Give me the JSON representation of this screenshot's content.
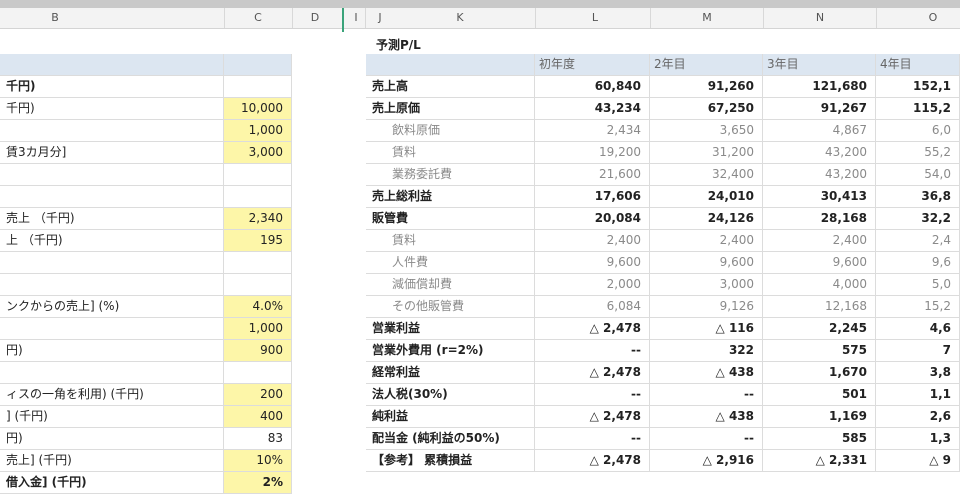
{
  "columns": [
    "B",
    "C",
    "D",
    "I",
    "J",
    "K",
    "L",
    "M",
    "N",
    "O"
  ],
  "left_panel": {
    "rows": [
      {
        "label": "",
        "value": ""
      },
      {
        "label": "千円)",
        "value": ""
      },
      {
        "label": "千円)",
        "value": "10,000"
      },
      {
        "label": "",
        "value": "1,000"
      },
      {
        "label": "賃3カ月分]",
        "value": "3,000"
      },
      {
        "label": "",
        "value": ""
      },
      {
        "label": "",
        "value": ""
      },
      {
        "label": "売上 （千円)",
        "value": "2,340"
      },
      {
        "label": "上 （千円)",
        "value": "195"
      },
      {
        "label": "",
        "value": ""
      },
      {
        "label": "",
        "value": ""
      },
      {
        "label": "ンクからの売上] (%)",
        "value": "4.0%"
      },
      {
        "label": "",
        "value": "1,000"
      },
      {
        "label": "円)",
        "value": "900"
      },
      {
        "label": "",
        "value": ""
      },
      {
        "label": "ィスの一角を利用) (千円)",
        "value": "200"
      },
      {
        "label": "] (千円)",
        "value": "400"
      },
      {
        "label": "円)",
        "value": "83"
      },
      {
        "label": "売上] (千円)",
        "value": "10%"
      },
      {
        "label": "借入金] (千円)",
        "value": "2%"
      }
    ]
  },
  "pl": {
    "title": "予測P/L",
    "headers": [
      "初年度",
      "2年目",
      "3年目",
      "4年目"
    ],
    "rows": [
      {
        "label": "売上高",
        "bold": true,
        "indent": false,
        "values": [
          "60,840",
          "91,260",
          "121,680",
          "152,1"
        ]
      },
      {
        "label": "売上原価",
        "bold": true,
        "indent": false,
        "values": [
          "43,234",
          "67,250",
          "91,267",
          "115,2"
        ]
      },
      {
        "label": "飲料原価",
        "bold": false,
        "indent": true,
        "values": [
          "2,434",
          "3,650",
          "4,867",
          "6,0"
        ]
      },
      {
        "label": "賃料",
        "bold": false,
        "indent": true,
        "values": [
          "19,200",
          "31,200",
          "43,200",
          "55,2"
        ]
      },
      {
        "label": "業務委託費",
        "bold": false,
        "indent": true,
        "values": [
          "21,600",
          "32,400",
          "43,200",
          "54,0"
        ]
      },
      {
        "label": "売上総利益",
        "bold": true,
        "indent": false,
        "values": [
          "17,606",
          "24,010",
          "30,413",
          "36,8"
        ]
      },
      {
        "label": "販管費",
        "bold": true,
        "indent": false,
        "values": [
          "20,084",
          "24,126",
          "28,168",
          "32,2"
        ]
      },
      {
        "label": "賃料",
        "bold": false,
        "indent": true,
        "values": [
          "2,400",
          "2,400",
          "2,400",
          "2,4"
        ]
      },
      {
        "label": "人件費",
        "bold": false,
        "indent": true,
        "values": [
          "9,600",
          "9,600",
          "9,600",
          "9,6"
        ]
      },
      {
        "label": "減価償却費",
        "bold": false,
        "indent": true,
        "values": [
          "2,000",
          "3,000",
          "4,000",
          "5,0"
        ]
      },
      {
        "label": "その他販管費",
        "bold": false,
        "indent": true,
        "values": [
          "6,084",
          "9,126",
          "12,168",
          "15,2"
        ]
      },
      {
        "label": "営業利益",
        "bold": true,
        "indent": false,
        "values": [
          "△ 2,478",
          "△ 116",
          "2,245",
          "4,6"
        ]
      },
      {
        "label": "営業外費用 (r=2%)",
        "bold": true,
        "indent": false,
        "values": [
          "--",
          "322",
          "575",
          "7"
        ]
      },
      {
        "label": "経常利益",
        "bold": true,
        "indent": false,
        "values": [
          "△ 2,478",
          "△ 438",
          "1,670",
          "3,8"
        ]
      },
      {
        "label": "法人税(30%)",
        "bold": true,
        "indent": false,
        "values": [
          "--",
          "--",
          "501",
          "1,1"
        ]
      },
      {
        "label": "純利益",
        "bold": true,
        "indent": false,
        "values": [
          "△ 2,478",
          "△ 438",
          "1,169",
          "2,6"
        ]
      },
      {
        "label": "配当金 (純利益の50%)",
        "bold": true,
        "indent": false,
        "values": [
          "--",
          "--",
          "585",
          "1,3"
        ]
      },
      {
        "label": "【参考】 累積損益",
        "bold": true,
        "indent": false,
        "values": [
          "△ 2,478",
          "△ 2,916",
          "△ 2,331",
          "△ 9"
        ]
      }
    ]
  }
}
